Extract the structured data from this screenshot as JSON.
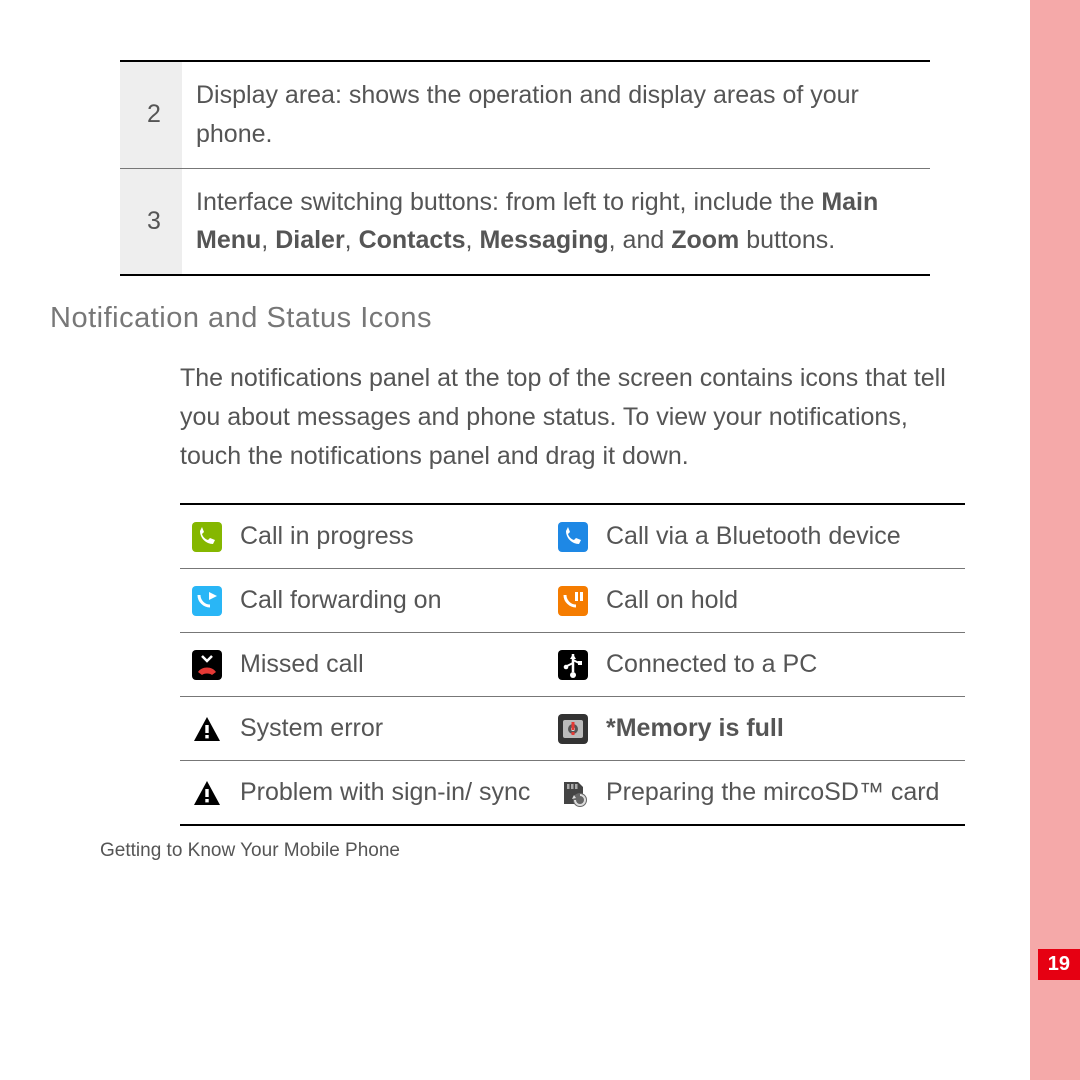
{
  "rows": [
    {
      "num": "2",
      "text_plain": "Display area: shows the operation and display areas of your phone."
    },
    {
      "num": "3",
      "text_html": "Interface switching buttons: from left to right, include the <span class=\"bold\">Main Menu</span>, <span class=\"bold\">Dialer</span>, <span class=\"bold\">Contacts</span>, <span class=\"bold\">Messaging</span>, and <span class=\"bold\">Zoom</span> buttons."
    }
  ],
  "section_heading": "Notification and Status Icons",
  "paragraph": "The notifications panel at the top of the screen contains icons that tell you about messages and phone status. To view your notifications, touch the notifications panel and drag it down.",
  "icons": [
    {
      "left_icon": "call-in-progress-icon",
      "left_label": "Call in progress",
      "right_icon": "call-bluetooth-icon",
      "right_label": "Call via a Bluetooth device"
    },
    {
      "left_icon": "call-forwarding-icon",
      "left_label": "Call forwarding on",
      "right_icon": "call-on-hold-icon",
      "right_label": "Call on hold"
    },
    {
      "left_icon": "missed-call-icon",
      "left_label": "Missed call",
      "right_icon": "usb-connected-icon",
      "right_label": "Connected to a PC"
    },
    {
      "left_icon": "system-error-icon",
      "left_label": "System error",
      "right_icon": "memory-full-icon",
      "right_label_html": "<span class=\"bold\">*Memory is full</span>"
    },
    {
      "left_icon": "sync-problem-icon",
      "left_label": "Problem with sign-in/ sync",
      "right_icon": "preparing-sd-icon",
      "right_label": "Preparing the mircoSD™ card"
    }
  ],
  "footer": "Getting to Know Your Mobile Phone",
  "page_number": "19",
  "icon_svg": {
    "call-in-progress-icon": "<svg width=30 height=30><rect width=30 height=30 rx=4 fill='#85b700'/><path d='M8 9c0 7 6 13 13 13l2-4-5-2-2 2c-3-1-5-3-6-6l2-2-2-5z' fill='#fff'/></svg>",
    "call-bluetooth-icon": "<svg width=30 height=30><rect width=30 height=30 rx=4 fill='#1e88e5'/><path d='M8 9c0 7 6 13 13 13l2-4-5-2-2 2c-3-1-5-3-6-6l2-2-2-5z' fill='#fff'/></svg>",
    "call-forwarding-icon": "<svg width=30 height=30><rect width=30 height=30 rx=4 fill='#29b6f6'/><path d='M7 9c0 6 5 11 11 11' stroke='#fff' stroke-width='3' fill='none'/><path d='M17 6l8 4-8 4z' fill='#fff'/></svg>",
    "call-on-hold-icon": "<svg width=30 height=30><rect width=30 height=30 rx=4 fill='#f57c00'/><path d='M7 9c0 6 5 11 11 11' stroke='#fff' stroke-width='3' fill='none'/><rect x='17' y='6' width='3' height='9' fill='#fff'/><rect x='22' y='6' width='3' height='9' fill='#fff'/></svg>",
    "missed-call-icon": "<svg width=30 height=30><rect width=30 height=30 rx=4 fill='#000'/><path d='M6 22c4-6 14-6 18 0l-4 3c-2-2-8-2-10 0z' fill='#e53935'/><path d='M10 6l5 5 5-5' stroke='#fff' stroke-width='2.5' fill='none'/></svg>",
    "usb-connected-icon": "<svg width=30 height=30><rect width=30 height=30 rx=4 fill='#000'/><path d='M15 4v18' stroke='#fff' stroke-width='2.5'/><circle cx='15' cy='25' r='3' fill='#fff'/><path d='M15 4l-3 5h6z' fill='#fff'/><path d='M15 13l-6 3M15 10l6 3' stroke='#fff' stroke-width='2'/><rect x='20' y='11' width='4' height='4' fill='#fff'/><circle cx='8' cy='17' r='2.3' fill='#fff'/></svg>",
    "system-error-icon": "<svg width=30 height=30><path d='M15 3 L28 27 H2 Z' fill='#000'/><rect x='13.3' y='11' width='3.4' height='8' fill='#fff'/><rect x='13.3' y='21' width='3.4' height='3.4' fill='#fff'/></svg>",
    "sync-problem-icon": "<svg width=30 height=30><path d='M15 3 L28 27 H2 Z' fill='#000'/><rect x='13.3' y='11' width='3.4' height='8' fill='#fff'/><rect x='13.3' y='21' width='3.4' height='3.4' fill='#fff'/></svg>",
    "memory-full-icon": "<svg width=30 height=30><rect width=30 height=30 rx=4 fill='#333'/><rect x='5' y='6' width='20' height='18' rx='2' fill='#bbb'/><circle cx='15' cy='15' r='5' fill='#555'/><circle cx='15' cy='15' r='2' fill='#ddd'/><rect x='13.5' y='8' width='3' height='8' fill='#e53935'/><rect x='13.5' y='18' width='3' height='3' fill='#e53935'/></svg>",
    "preparing-sd-icon": "<svg width=30 height=30><path d='M6 4h14l5 5v17H6z' fill='#444'/><rect x='9' y='6' width='2.5' height='5' fill='#aaa'/><rect x='13' y='6' width='2.5' height='5' fill='#aaa'/><rect x='17' y='6' width='2.5' height='5' fill='#aaa'/><circle cx='22' cy='22' r='7' fill='#666'/><path d='M22 17a5 5 0 1 1-5 5' stroke='#ddd' stroke-width='2' fill='none'/><path d='M16 17l-2 4 4-1z' fill='#ddd'/></svg>"
  }
}
